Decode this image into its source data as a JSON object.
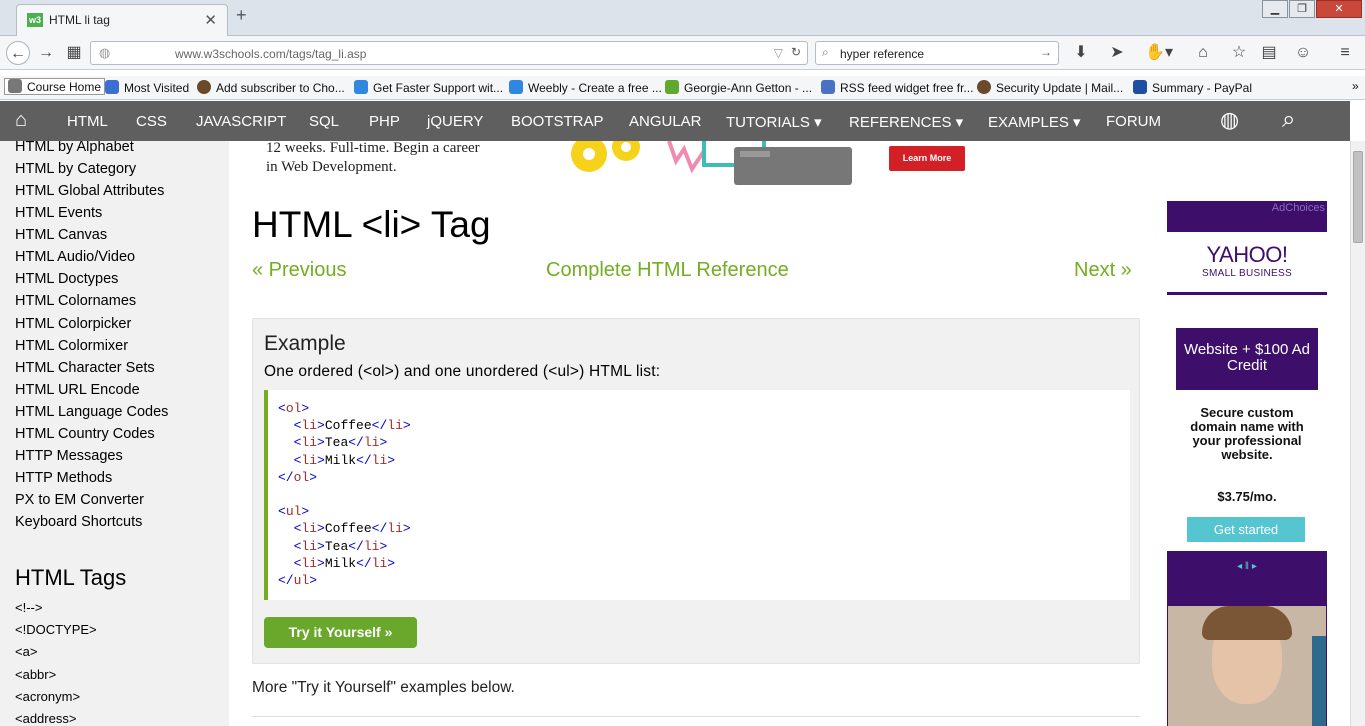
{
  "browser": {
    "tab_title": "HTML li tag",
    "tab_favicon": "w3",
    "url": "www.w3schools.com/tags/tag_li.asp",
    "search_query": "hyper reference"
  },
  "bookmarks": [
    {
      "label": "Course Home",
      "icon": "page-icon",
      "color": "#777777"
    },
    {
      "label": "Most Visited",
      "icon": "star-icon",
      "color": "#3b6fd1"
    },
    {
      "label": "Add subscriber to Cho...",
      "icon": "mailchimp-icon",
      "color": "#6b4a2b"
    },
    {
      "label": "Get Faster Support wit...",
      "icon": "weebly-icon",
      "color": "#2f87e0"
    },
    {
      "label": "Weebly - Create a free ...",
      "icon": "weebly-icon",
      "color": "#2f87e0"
    },
    {
      "label": "Georgie-Ann Getton - ...",
      "icon": "n-icon",
      "color": "#61a830"
    },
    {
      "label": "RSS feed widget free fr...",
      "icon": "rss-icon",
      "color": "#4a72c4"
    },
    {
      "label": "Security Update | Mail...",
      "icon": "mailchimp-icon",
      "color": "#6b4a2b"
    },
    {
      "label": "Summary - PayPal",
      "icon": "paypal-icon",
      "color": "#1f4fa0"
    }
  ],
  "site_nav": {
    "items": [
      "HTML",
      "CSS",
      "JAVASCRIPT",
      "SQL",
      "PHP",
      "jQUERY",
      "BOOTSTRAP",
      "ANGULAR",
      "TUTORIALS ▾",
      "REFERENCES ▾",
      "EXAMPLES ▾",
      "FORUM"
    ]
  },
  "sidebar": {
    "links": [
      "HTML by Alphabet",
      "HTML by Category",
      "HTML Global Attributes",
      "HTML Events",
      "HTML Canvas",
      "HTML Audio/Video",
      "HTML Doctypes",
      "HTML Colornames",
      "HTML Colorpicker",
      "HTML Colormixer",
      "HTML Character Sets",
      "HTML URL Encode",
      "HTML Language Codes",
      "HTML Country Codes",
      "HTTP Messages",
      "HTTP Methods",
      "PX to EM Converter",
      "Keyboard Shortcuts"
    ],
    "tags_heading": "HTML Tags",
    "tags": [
      "<!-->",
      "<!DOCTYPE>",
      "<a>",
      "<abbr>",
      "<acronym>",
      "<address>"
    ]
  },
  "top_ad": {
    "line1": "12 weeks. Full-time. Begin a career",
    "line2": "in Web Development.",
    "button": "Learn More"
  },
  "main": {
    "title": "HTML <li> Tag",
    "previous": "« Previous",
    "reference": "Complete HTML Reference",
    "next": "Next »",
    "example_heading": "Example",
    "example_desc": "One ordered (<ol>) and one unordered (<ul>) HTML list:",
    "code_lines": [
      "<ol>",
      "  <li>Coffee</li>",
      "  <li>Tea</li>",
      "  <li>Milk</li>",
      "</ol>",
      "",
      "<ul>",
      "  <li>Coffee</li>",
      "  <li>Tea</li>",
      "  <li>Milk</li>",
      "</ul>"
    ],
    "try_button": "Try it Yourself »",
    "more_text": "More \"Try it Yourself\" examples below."
  },
  "right_ad": {
    "adchoices": "AdChoices",
    "brand": "YAHOO!",
    "brand_sub": "SMALL BUSINESS",
    "offer": "Website + $100 Ad Credit",
    "body": "Secure custom domain name with your professional website.",
    "price": "$3.75/mo.",
    "cta": "Get started"
  },
  "colors": {
    "accent": "#73ad21",
    "nav_bg": "#5f5f5f",
    "sidebar_bg": "#f1f1f1",
    "yahoo_purple": "#3d0f6b"
  }
}
